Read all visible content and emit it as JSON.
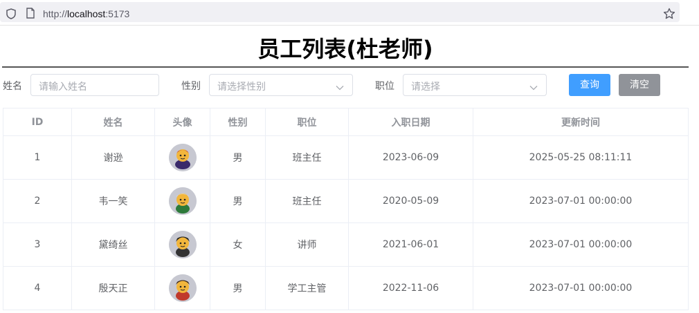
{
  "browser": {
    "url_prefix": "http://",
    "url_host": "localhost",
    "url_port": ":5173"
  },
  "page": {
    "title": "员工列表(杜老师)"
  },
  "search": {
    "name_label": "姓名",
    "name_placeholder": "请输入姓名",
    "gender_label": "性别",
    "gender_placeholder": "请选择性别",
    "job_label": "职位",
    "job_placeholder": "请选择",
    "query_button": "查询",
    "clear_button": "清空"
  },
  "table": {
    "headers": {
      "id": "ID",
      "name": "姓名",
      "image": "头像",
      "gender": "性别",
      "job": "职位",
      "entry_date": "入职日期",
      "update_time": "更新时间"
    },
    "rows": [
      {
        "id": "1",
        "name": "谢逊",
        "gender": "男",
        "job": "班主任",
        "entry_date": "2023-06-09",
        "update_time": "2025-05-25 08:11:11"
      },
      {
        "id": "2",
        "name": "韦一笑",
        "gender": "男",
        "job": "班主任",
        "entry_date": "2020-05-09",
        "update_time": "2023-07-01 00:00:00"
      },
      {
        "id": "3",
        "name": "黛绮丝",
        "gender": "女",
        "job": "讲师",
        "entry_date": "2021-06-01",
        "update_time": "2023-07-01 00:00:00"
      },
      {
        "id": "4",
        "name": "殷天正",
        "gender": "男",
        "job": "学工主管",
        "entry_date": "2022-11-06",
        "update_time": "2023-07-01 00:00:00"
      }
    ]
  },
  "colors": {
    "primary": "#409eff",
    "info": "#909399",
    "header_text": "#909399",
    "border": "#ebeef5"
  }
}
